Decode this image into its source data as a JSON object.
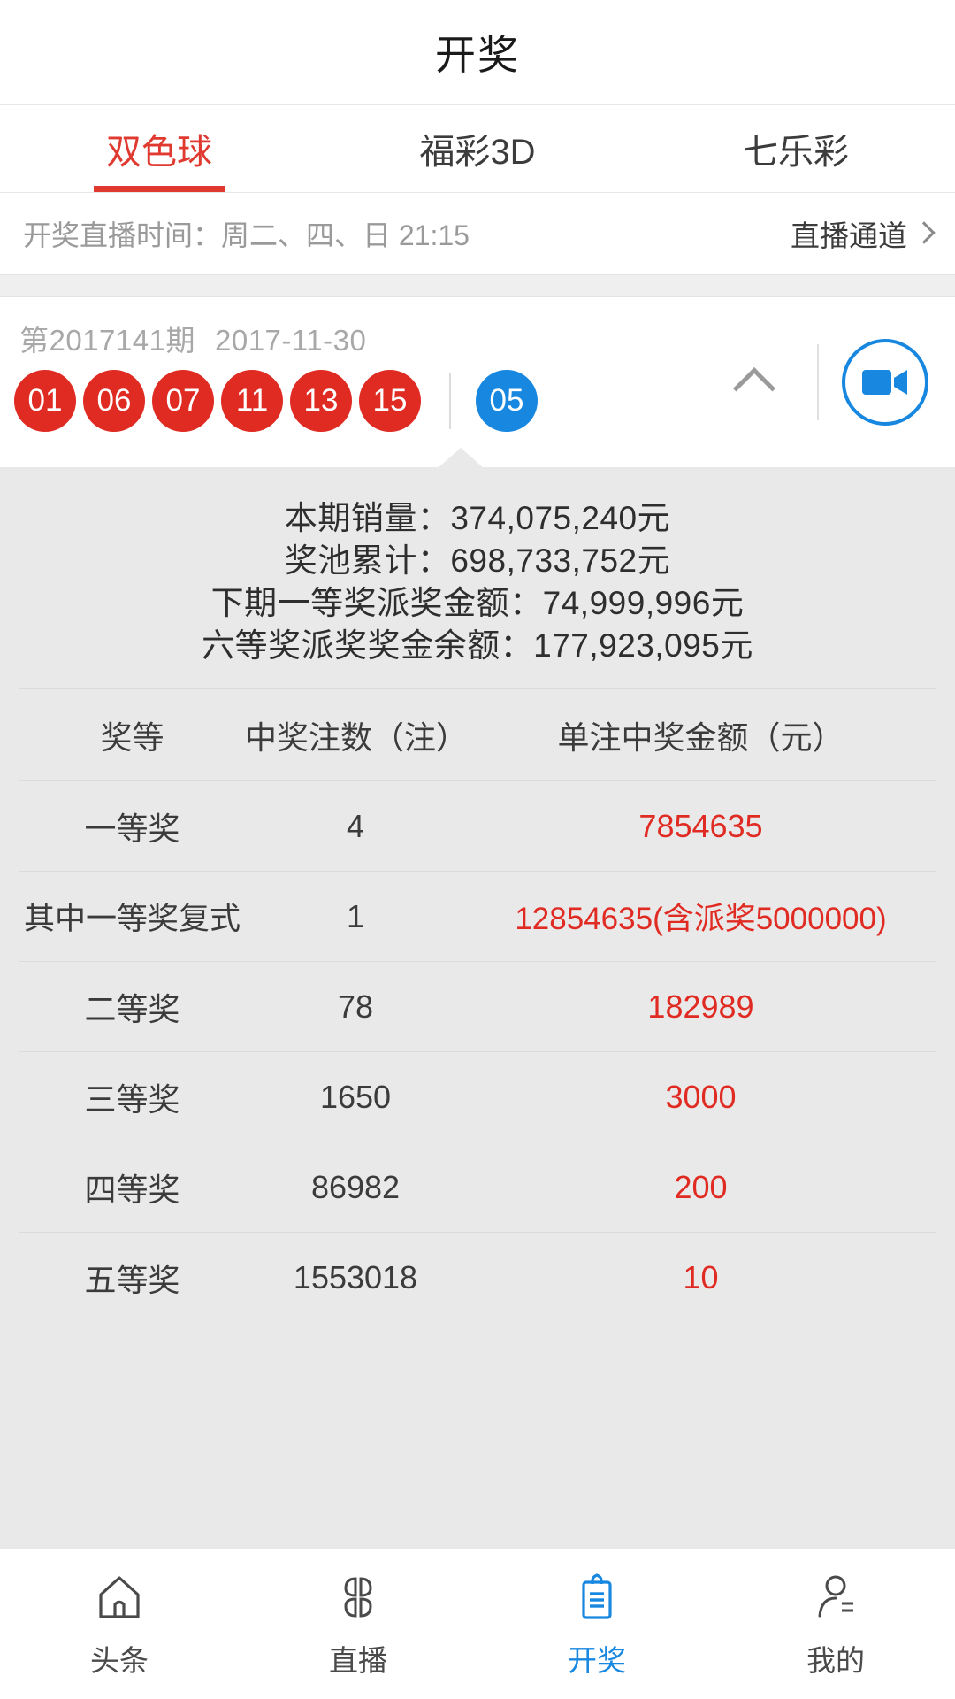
{
  "header": {
    "title": "开奖"
  },
  "tabs": [
    {
      "label": "双色球",
      "active": true
    },
    {
      "label": "福彩3D",
      "active": false
    },
    {
      "label": "七乐彩",
      "active": false
    }
  ],
  "live": {
    "time_label": "开奖直播时间：周二、四、日 21:15",
    "channel_label": "直播通道",
    "chevron_icon": "chevron-right-icon"
  },
  "draw": {
    "issue": "第2017141期",
    "date": "2017-11-30",
    "red_balls": [
      "01",
      "06",
      "07",
      "11",
      "13",
      "15"
    ],
    "blue_balls": [
      "05"
    ],
    "collapse_icon": "chevron-up-icon",
    "video_icon": "video-camera-icon"
  },
  "stats": {
    "lines": [
      "本期销量：374,075,240元",
      "奖池累计：698,733,752元",
      "下期一等奖派奖金额：74,999,996元",
      "六等奖派奖奖金余额：177,923,095元"
    ]
  },
  "prize_table": {
    "headers": [
      "奖等",
      "中奖注数（注）",
      "单注中奖金额（元）"
    ],
    "rows": [
      {
        "level": "一等奖",
        "count": "4",
        "amount": "7854635"
      },
      {
        "level": "其中一等奖复式",
        "count": "1",
        "amount": "12854635(含派奖5000000)"
      },
      {
        "level": "二等奖",
        "count": "78",
        "amount": "182989"
      },
      {
        "level": "三等奖",
        "count": "1650",
        "amount": "3000"
      },
      {
        "level": "四等奖",
        "count": "86982",
        "amount": "200"
      },
      {
        "level": "五等奖",
        "count": "1553018",
        "amount": "10"
      }
    ]
  },
  "bottom_nav": [
    {
      "label": "头条",
      "icon": "home-icon",
      "active": false
    },
    {
      "label": "直播",
      "icon": "clover-grid-icon",
      "active": false
    },
    {
      "label": "开奖",
      "icon": "clipboard-icon",
      "active": true
    },
    {
      "label": "我的",
      "icon": "user-icon",
      "active": false
    }
  ],
  "colors": {
    "accent_red": "#e02b23",
    "accent_blue": "#1787e0",
    "panel_gray": "#e9e9e9",
    "muted_text": "#9a9a9a"
  }
}
